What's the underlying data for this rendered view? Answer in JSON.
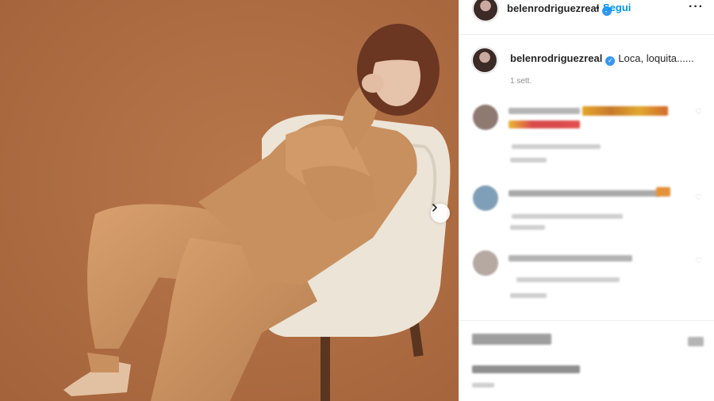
{
  "post": {
    "username": "belenrodriguezreal",
    "follow_label": "Segui",
    "follow_separator": "•",
    "caption": "Loca, loquita......",
    "timestamp": "1 sett."
  },
  "colors": {
    "photo_background": "#b06f43",
    "link_blue": "#0095f6",
    "verified_blue": "#3897f0",
    "muted_text": "#8e8e8e"
  },
  "icons": {
    "verified": "verified-badge-icon",
    "more": "more-options-icon",
    "next": "chevron-right-icon",
    "like": "heart-icon"
  }
}
